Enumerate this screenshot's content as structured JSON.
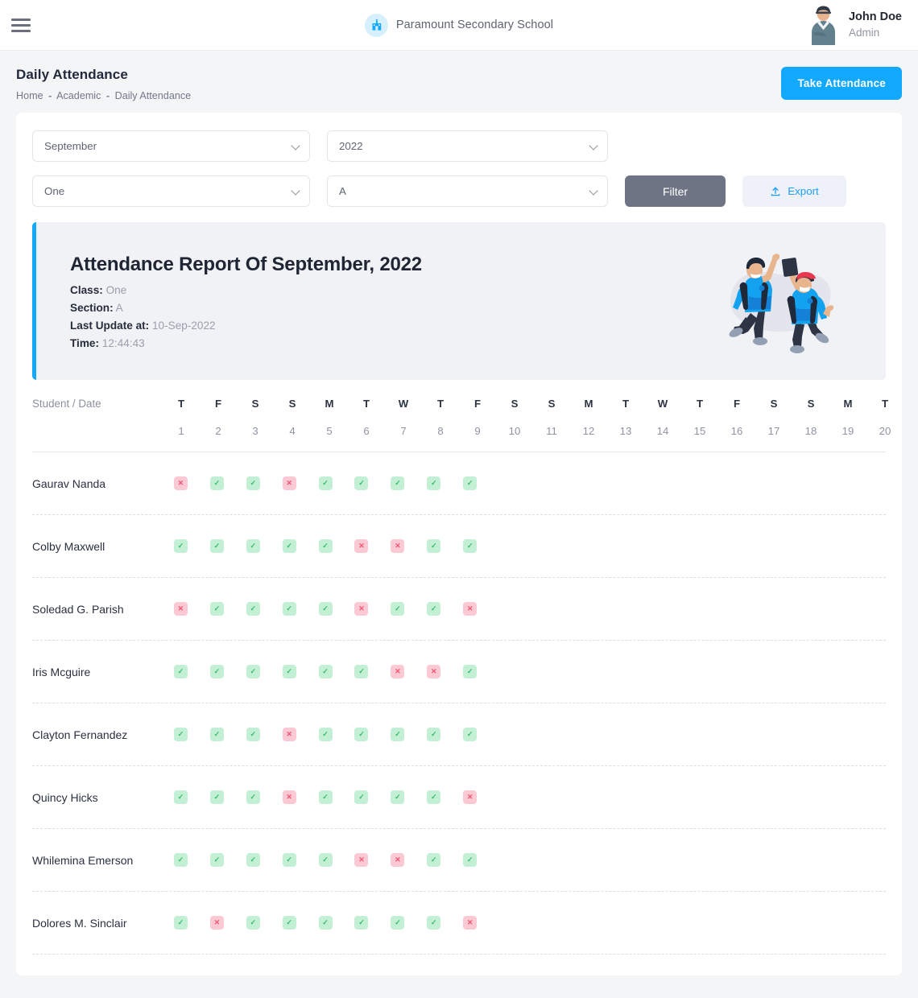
{
  "topbar": {
    "menu_icon": "hamburger-menu-icon",
    "brand_icon": "school-building-icon",
    "brand_name": "Paramount Secondary School",
    "user_name": "John Doe",
    "user_role": "Admin"
  },
  "pagehead": {
    "title": "Daily Attendance",
    "breadcrumb": [
      "Home",
      "Academic",
      "Daily Attendance"
    ],
    "separator": "-",
    "take_attendance_label": "Take Attendance"
  },
  "filters": {
    "month": "September",
    "year": "2022",
    "class": "One",
    "section": "A",
    "filter_label": "Filter",
    "export_label": "Export",
    "export_icon": "upload-icon"
  },
  "report": {
    "title": "Attendance Report Of September, 2022",
    "class_label": "Class:",
    "class_value": "One",
    "section_label": "Section:",
    "section_value": "A",
    "last_update_label": "Last Update at:",
    "last_update_value": "10-Sep-2022",
    "time_label": "Time:",
    "time_value": "12:44:43",
    "illustration": "jumping-students-illustration"
  },
  "table": {
    "name_header": "Student / Date",
    "day_letters": [
      "T",
      "F",
      "S",
      "S",
      "M",
      "T",
      "W",
      "T",
      "F",
      "S",
      "S",
      "M",
      "T",
      "W",
      "T",
      "F",
      "S",
      "S",
      "M",
      "T"
    ],
    "day_numbers": [
      "1",
      "2",
      "3",
      "4",
      "5",
      "6",
      "7",
      "8",
      "9",
      "10",
      "11",
      "12",
      "13",
      "14",
      "15",
      "16",
      "17",
      "18",
      "19",
      "20"
    ],
    "present_symbol": "✓",
    "absent_symbol": "✕",
    "rows": [
      {
        "name": "Gaurav Nanda",
        "marks": [
          "A",
          "P",
          "P",
          "A",
          "P",
          "P",
          "P",
          "P",
          "P"
        ]
      },
      {
        "name": "Colby Maxwell",
        "marks": [
          "P",
          "P",
          "P",
          "P",
          "P",
          "A",
          "A",
          "P",
          "P"
        ]
      },
      {
        "name": "Soledad G. Parish",
        "marks": [
          "A",
          "P",
          "P",
          "P",
          "P",
          "A",
          "P",
          "P",
          "A"
        ]
      },
      {
        "name": "Iris Mcguire",
        "marks": [
          "P",
          "P",
          "P",
          "P",
          "P",
          "P",
          "A",
          "A",
          "P"
        ]
      },
      {
        "name": "Clayton Fernandez",
        "marks": [
          "P",
          "P",
          "P",
          "A",
          "P",
          "P",
          "P",
          "P",
          "P"
        ]
      },
      {
        "name": "Quincy Hicks",
        "marks": [
          "P",
          "P",
          "P",
          "A",
          "P",
          "P",
          "P",
          "P",
          "A"
        ]
      },
      {
        "name": "Whilemina Emerson",
        "marks": [
          "P",
          "P",
          "P",
          "P",
          "P",
          "A",
          "A",
          "P",
          "P"
        ]
      },
      {
        "name": "Dolores M. Sinclair",
        "marks": [
          "P",
          "A",
          "P",
          "P",
          "P",
          "P",
          "P",
          "P",
          "A"
        ]
      }
    ]
  },
  "colors": {
    "accent_blue": "#12a9fc",
    "filter_gray": "#6e7484",
    "present_bg": "#c3f0d4",
    "present_fg": "#3bb96d",
    "absent_bg": "#fbc9d3",
    "absent_fg": "#ef5573"
  }
}
